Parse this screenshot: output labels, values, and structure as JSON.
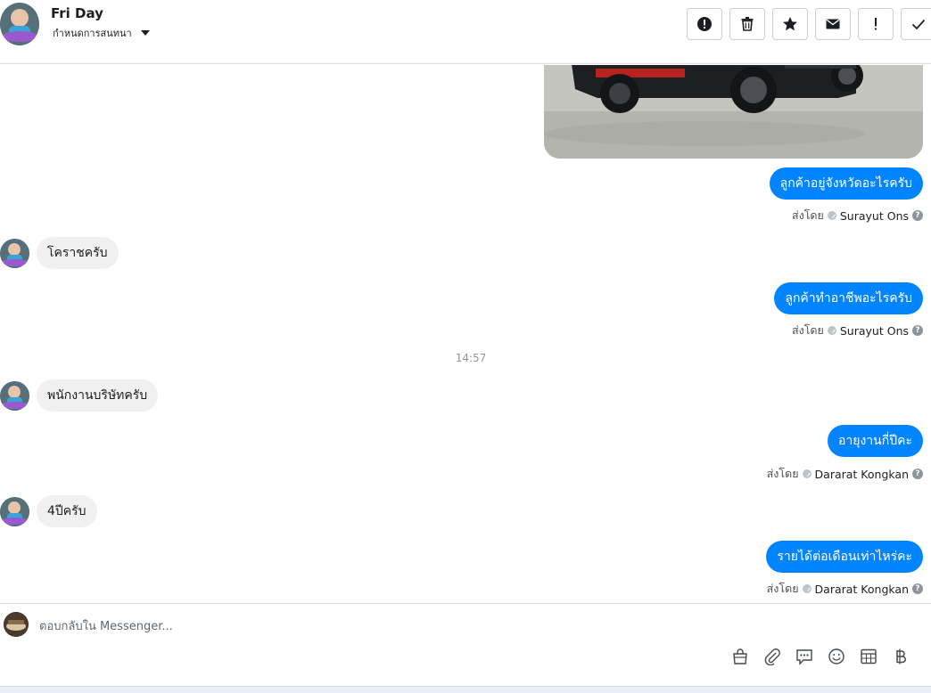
{
  "header": {
    "contact_name": "Fri Day",
    "subtitle": "กำหนดการสนทนา",
    "actions": [
      "report-icon",
      "trash-icon",
      "star-icon",
      "envelope-icon",
      "exclamation-icon",
      "check-icon"
    ]
  },
  "conversation": {
    "messages": [
      {
        "direction": "out",
        "text": "ลูกค้าอยู่จังหวัดอะไรครับ"
      },
      {
        "direction": "out",
        "sent_by_label": "ส่งโดย",
        "sender": "Surayut Ons"
      },
      {
        "direction": "in",
        "text": "โคราชครับ"
      },
      {
        "direction": "out",
        "text": "ลูกค้าทำอาชีพอะไรครับ"
      },
      {
        "direction": "out",
        "sent_by_label": "ส่งโดย",
        "sender": "Surayut Ons"
      },
      {
        "direction": "in",
        "text": "พนักงานบริษัทครับ"
      },
      {
        "direction": "out",
        "text": "อายุงานกี่ปีคะ"
      },
      {
        "direction": "out",
        "sent_by_label": "ส่งโดย",
        "sender": "Dararat Kongkan"
      },
      {
        "direction": "in",
        "text": "4ปีครับ"
      },
      {
        "direction": "out",
        "text": "รายได้ต่อเดือนเท่าไหร่คะ"
      },
      {
        "direction": "out",
        "sent_by_label": "ส่งโดย",
        "sender": "Dararat Kongkan"
      }
    ],
    "timestamp": "14:57"
  },
  "composer": {
    "placeholder": "ตอบกลับใน Messenger...",
    "tools": [
      "bag-icon",
      "paperclip-icon",
      "quick-reply-icon",
      "emoji-icon",
      "table-icon",
      "baht-icon"
    ]
  },
  "colors": {
    "outgoing_bubble": "#0084ff",
    "incoming_bubble": "#f0f0f0"
  }
}
